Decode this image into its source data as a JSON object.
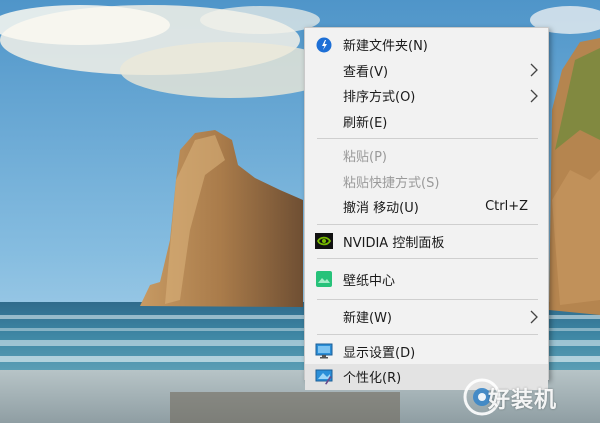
{
  "menu": {
    "items": [
      {
        "id": "new-folder",
        "label": "新建文件夹(N)",
        "icon": "new-folder-icon"
      },
      {
        "id": "view",
        "label": "查看(V)",
        "submenu": true
      },
      {
        "id": "sort",
        "label": "排序方式(O)",
        "submenu": true
      },
      {
        "id": "refresh",
        "label": "刷新(E)"
      },
      {
        "id": "paste",
        "label": "粘贴(P)",
        "disabled": true
      },
      {
        "id": "paste-shortcut",
        "label": "粘贴快捷方式(S)",
        "disabled": true
      },
      {
        "id": "undo-move",
        "label": "撤消 移动(U)",
        "shortcut": "Ctrl+Z"
      },
      {
        "id": "nvidia",
        "label": "NVIDIA 控制面板",
        "icon": "nvidia-icon"
      },
      {
        "id": "wallpaper",
        "label": "壁纸中心",
        "icon": "wallpaper-icon"
      },
      {
        "id": "new",
        "label": "新建(W)",
        "submenu": true
      },
      {
        "id": "display",
        "label": "显示设置(D)",
        "icon": "display-icon"
      },
      {
        "id": "personalize",
        "label": "个性化(R)",
        "icon": "personalize-icon",
        "highlighted": true
      }
    ]
  },
  "watermark": {
    "text": "好装机"
  },
  "colors": {
    "menu_bg": "#f2f2f2",
    "highlight": "#e3e3e3",
    "disabled": "#9a9a9a",
    "nvidia": "#76b900",
    "wallpaper": "#2ecc71"
  }
}
